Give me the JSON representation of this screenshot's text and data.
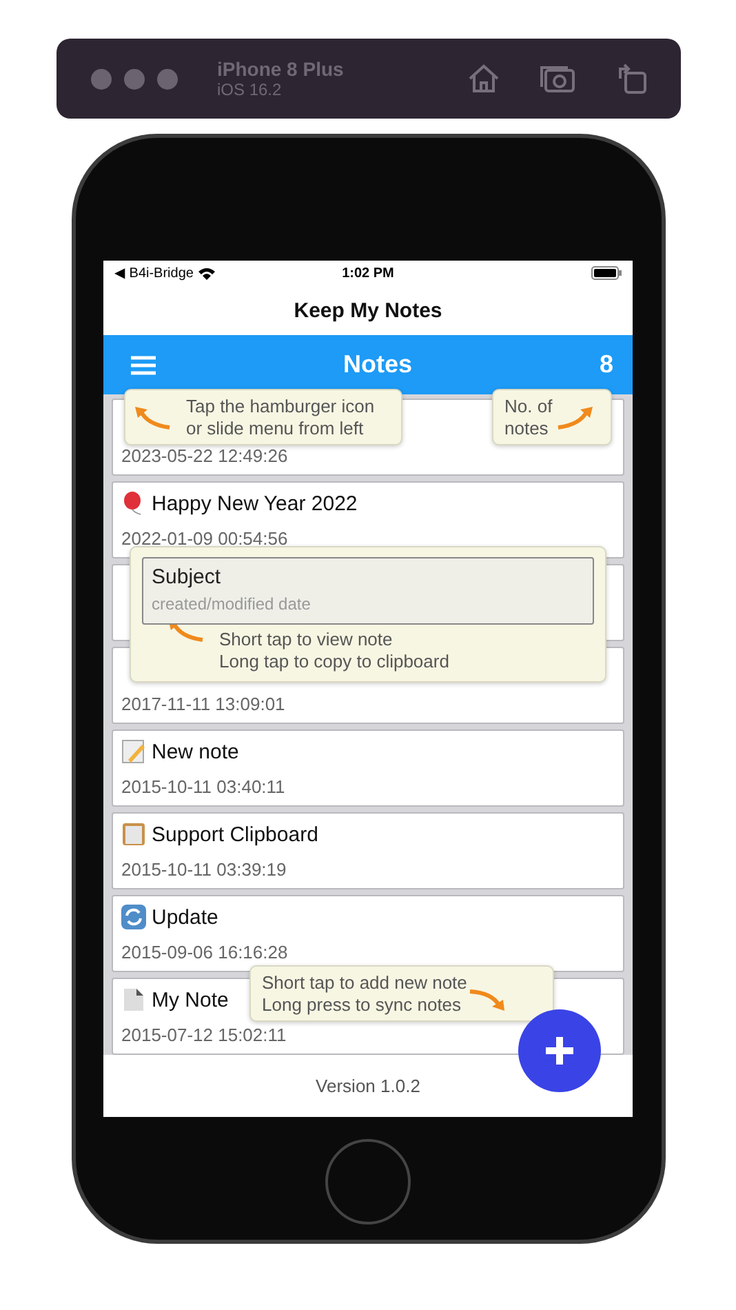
{
  "simulator": {
    "device": "iPhone 8 Plus",
    "os": "iOS 16.2"
  },
  "status_bar": {
    "back_app": "◀ B4i-Bridge",
    "time": "1:02 PM"
  },
  "app_title": "Keep My Notes",
  "header": {
    "title": "Notes",
    "count": "8"
  },
  "notes": [
    {
      "kind": "plain",
      "date": "2023-05-22 12:49:26"
    },
    {
      "kind": "balloon",
      "title": "Happy New Year 2022",
      "date": "2022-01-09 00:54:56"
    },
    {
      "kind": "plain"
    },
    {
      "kind": "plain",
      "date": "2017-11-11 13:09:01"
    },
    {
      "kind": "memo",
      "title": "New note",
      "date": "2015-10-11 03:40:11"
    },
    {
      "kind": "clipboard",
      "title": "Support Clipboard",
      "date": "2015-10-11 03:39:19"
    },
    {
      "kind": "sync",
      "title": "Update",
      "date": "2015-09-06 16:16:28"
    },
    {
      "kind": "document",
      "title": "My Note",
      "date": "2015-07-12 15:02:11"
    }
  ],
  "footer": {
    "version": "Version 1.0.2"
  },
  "hints": {
    "menu": [
      "Tap the hamburger icon",
      "or slide menu from left"
    ],
    "count": [
      "No. of",
      "notes"
    ],
    "row_sample": {
      "subject": "Subject",
      "date": "created/modified date"
    },
    "row": [
      "Short tap to view note",
      "Long tap to copy to clipboard"
    ],
    "add": [
      "Short tap to add new note",
      "Long press to sync notes"
    ]
  }
}
